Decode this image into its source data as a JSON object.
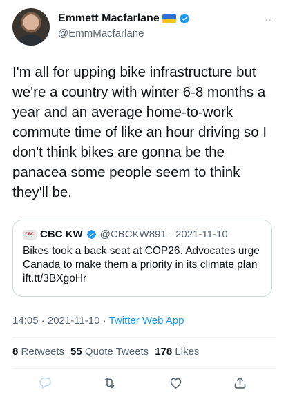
{
  "author": {
    "name": "Emmett Macfarlane",
    "handle": "@EmmMacfarlane"
  },
  "icons": [
    "avatar",
    "ukraine-flag-icon",
    "verified-icon",
    "more-icon",
    "cbc-logo-icon",
    "reply-icon",
    "retweet-icon",
    "like-icon",
    "share-icon"
  ],
  "colors": {
    "accent": "#1d9bf0",
    "text": "#0f1419",
    "muted": "#536471"
  },
  "more_label": "···",
  "tweet": {
    "text": "I'm all for upping bike infrastructure but we're a country with winter 6-8 months a year and an average home-to-work commute time of like an hour driving so I don't think bikes are gonna be the panacea some people seem to think they'll be."
  },
  "quote": {
    "logo_text": "CBC",
    "name": "CBC KW",
    "handle_date": "@CBCKW891 · 2021-11-10",
    "text": "Bikes took a back seat at COP26. Advocates urge Canada to make them a priority in its climate plan ift.tt/3BXgoHr"
  },
  "meta": {
    "time_date": "14:05 · 2021-11-10 · ",
    "source": "Twitter Web App"
  },
  "stats": {
    "retweets_count": "8",
    "retweets_label": "Retweets",
    "quotes_count": "55",
    "quotes_label": "Quote Tweets",
    "likes_count": "178",
    "likes_label": "Likes"
  }
}
